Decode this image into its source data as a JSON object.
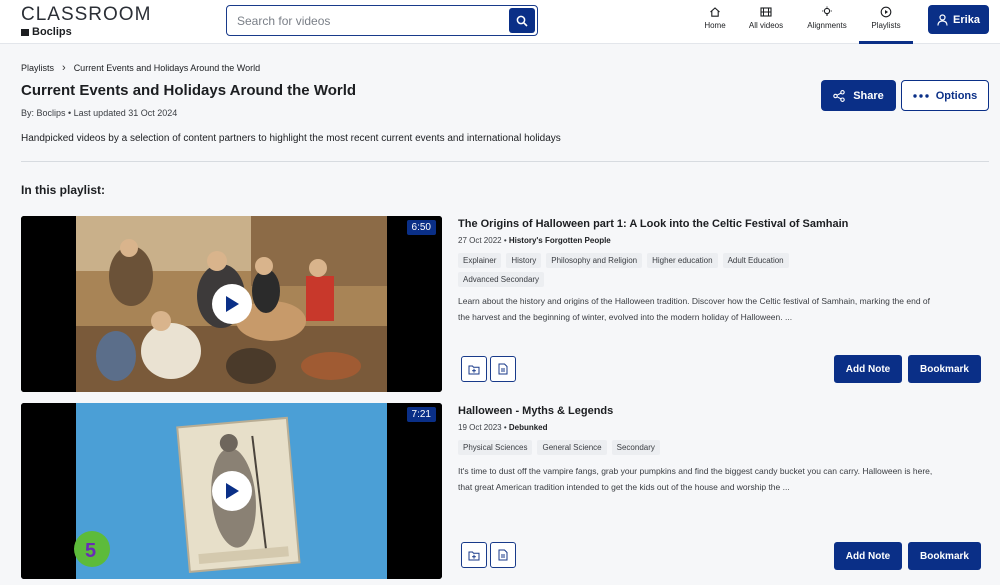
{
  "header": {
    "logo_main": "CLASSROOM",
    "logo_sub": "Boclips",
    "search_placeholder": "Search for videos",
    "nav": [
      {
        "label": "Home",
        "icon": "home-icon"
      },
      {
        "label": "All videos",
        "icon": "film-icon"
      },
      {
        "label": "Alignments",
        "icon": "lightbulb-icon"
      },
      {
        "label": "Playlists",
        "icon": "play-circle-icon",
        "active": true
      }
    ],
    "user_name": "Erika"
  },
  "breadcrumb": {
    "root": "Playlists",
    "current": "Current Events and Holidays Around the World"
  },
  "page": {
    "title": "Current Events and Holidays Around the World",
    "meta": "By: Boclips • Last updated 31 Oct 2024",
    "share_label": "Share",
    "options_label": "Options",
    "description": "Handpicked videos by a selection of content partners to highlight the most recent current events and international holidays",
    "section_heading": "In this playlist:"
  },
  "videos": [
    {
      "duration": "6:50",
      "title": "The Origins of Halloween part 1: A Look into the Celtic Festival of Samhain",
      "date": "27 Oct 2022",
      "channel": "History's Forgotten People",
      "tags": [
        "Explainer",
        "History",
        "Philosophy and Religion",
        "Higher education",
        "Adult Education",
        "Advanced Secondary"
      ],
      "description": "Learn about the history and origins of the Halloween tradition. Discover how the Celtic festival of Samhain, marking the end of the harvest and the beginning of winter, evolved into the modern holiday of Halloween. ...",
      "add_note_label": "Add Note",
      "bookmark_label": "Bookmark"
    },
    {
      "duration": "7:21",
      "title": "Halloween - Myths & Legends",
      "date": "19 Oct 2023",
      "channel": "Debunked",
      "tags": [
        "Physical Sciences",
        "General Science",
        "Secondary"
      ],
      "description": "It's time to dust off the vampire fangs, grab your pumpkins and find the biggest candy bucket you can carry. Halloween is here, that great American tradition intended to get the kids out of the house and worship the ...",
      "add_note_label": "Add Note",
      "bookmark_label": "Bookmark",
      "thumb_badge": "5"
    }
  ],
  "colors": {
    "primary": "#0a2f87",
    "thumb2_bg": "#4b9fd6",
    "badge_green": "#5dbb3a"
  }
}
